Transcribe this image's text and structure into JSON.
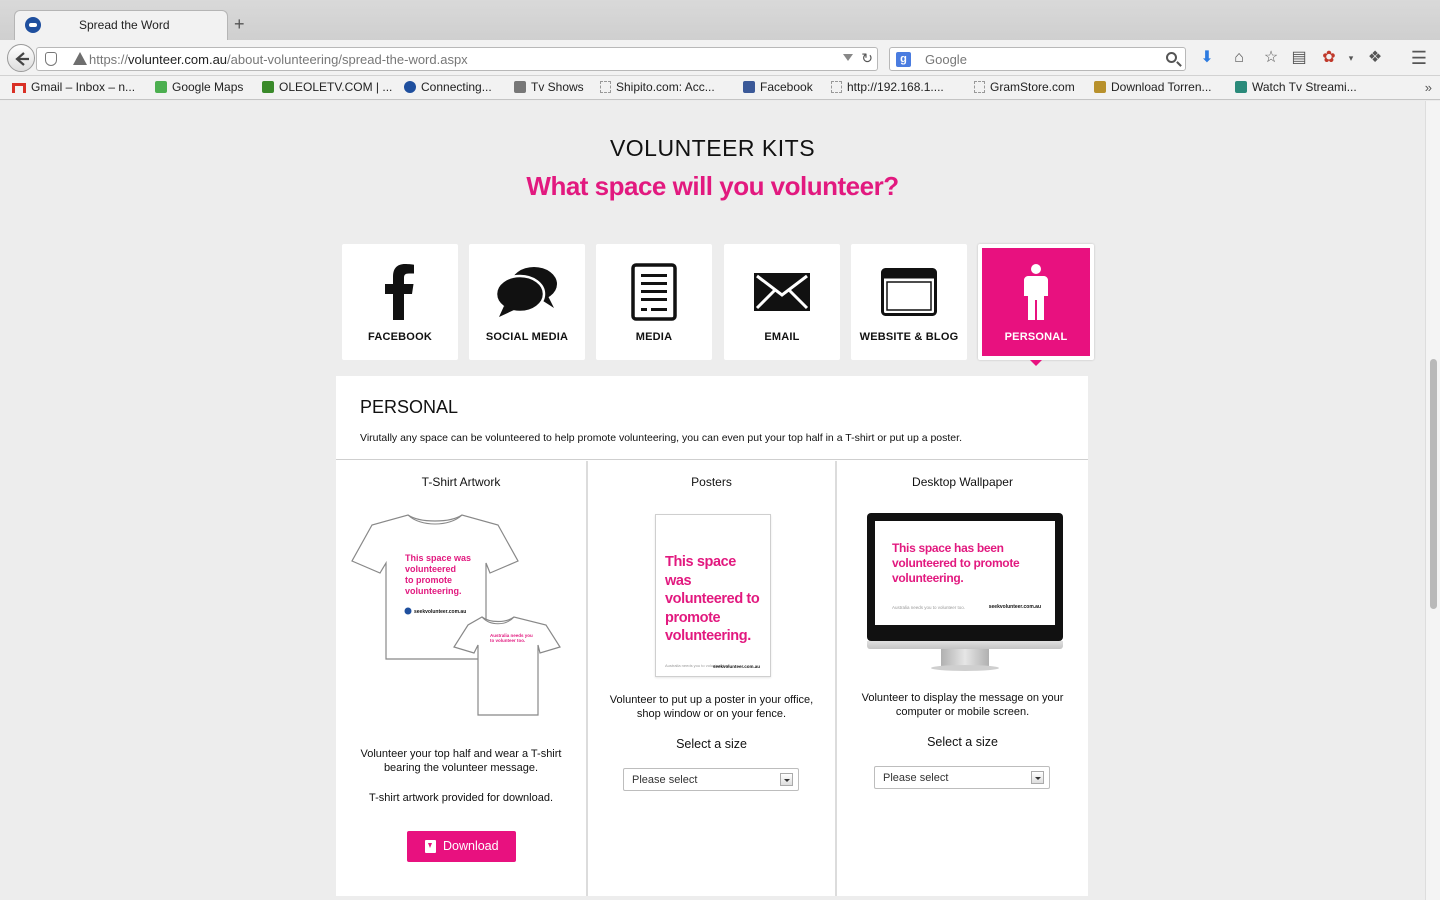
{
  "browser": {
    "tab_title": "Spread the Word",
    "new_tab_label": "+",
    "url_prefix": "https://",
    "url_domain": "volunteer.com.au",
    "url_path": "/about-volunteering/spread-the-word.aspx",
    "search_placeholder": "Google",
    "search_engine_badge": "g"
  },
  "bookmarks": [
    {
      "label": "Gmail – Inbox – n...",
      "icon": "gmail-icon",
      "color": "#d93025"
    },
    {
      "label": "Google Maps",
      "icon": "maps-icon",
      "color": "#4caf50"
    },
    {
      "label": "OLEOLETV.COM | ...",
      "icon": "runner-icon",
      "color": "#3a8a2a"
    },
    {
      "label": "Connecting...",
      "icon": "globe-icon",
      "color": "#1f4f9e"
    },
    {
      "label": "Tv Shows",
      "icon": "tv-icon",
      "color": "#777777"
    },
    {
      "label": "Shipito.com: Acc...",
      "icon": "page-icon",
      "color": "#999999"
    },
    {
      "label": "Facebook",
      "icon": "facebook-icon",
      "color": "#3b5998"
    },
    {
      "label": "http://192.168.1....",
      "icon": "page-icon",
      "color": "#999999"
    },
    {
      "label": "GramStore.com",
      "icon": "page-icon",
      "color": "#999999"
    },
    {
      "label": "Download Torren...",
      "icon": "shield-icon",
      "color": "#b8912c"
    },
    {
      "label": "Watch Tv Streami...",
      "icon": "tv-icon",
      "color": "#2a8a7a"
    }
  ],
  "bookmarks_more": "»",
  "page": {
    "heading": "VOLUNTEER KITS",
    "subheading": "What space will you volunteer?",
    "accent": "#e8117f",
    "tiles": [
      {
        "label": "FACEBOOK",
        "icon": "facebook-icon"
      },
      {
        "label": "SOCIAL MEDIA",
        "icon": "speech-bubbles-icon"
      },
      {
        "label": "MEDIA",
        "icon": "document-icon"
      },
      {
        "label": "EMAIL",
        "icon": "envelope-icon"
      },
      {
        "label": "WEBSITE & BLOG",
        "icon": "browser-window-icon"
      },
      {
        "label": "PERSONAL",
        "icon": "person-icon",
        "active": true
      }
    ],
    "panel": {
      "title": "PERSONAL",
      "description": "Virutally any space can be volunteered to help promote volunteering, you can even put your top half in a T-shirt or put up a poster.",
      "columns": [
        {
          "title": "T-Shirt Artwork",
          "text": "Volunteer your top half and wear a T-shirt bearing the volunteer message.",
          "text2": "T-shirt artwork provided for download.",
          "button": "Download",
          "art_front": "This space was volunteered to promote volunteering.",
          "art_logo": "seekvolunteer.com.au",
          "art_back": "Australia needs you to volunteer too."
        },
        {
          "title": "Posters",
          "text": "Volunteer to put up a poster in your office, shop window or on your fence.",
          "select_label": "Select a size",
          "select_value": "Please select",
          "art_head": "This space was volunteered to promote volunteering.",
          "art_foot": "Australia needs you to volunteer too.",
          "art_logo": "seekvolunteer.com.au"
        },
        {
          "title": "Desktop Wallpaper",
          "text": "Volunteer to display the message on your computer or mobile screen.",
          "select_label": "Select a size",
          "select_value": "Please select",
          "art_head": "This space has been volunteered to promote volunteering.",
          "art_foot": "Australia needs you to volunteer too.",
          "art_logo": "seekvolunteer.com.au"
        }
      ]
    }
  }
}
